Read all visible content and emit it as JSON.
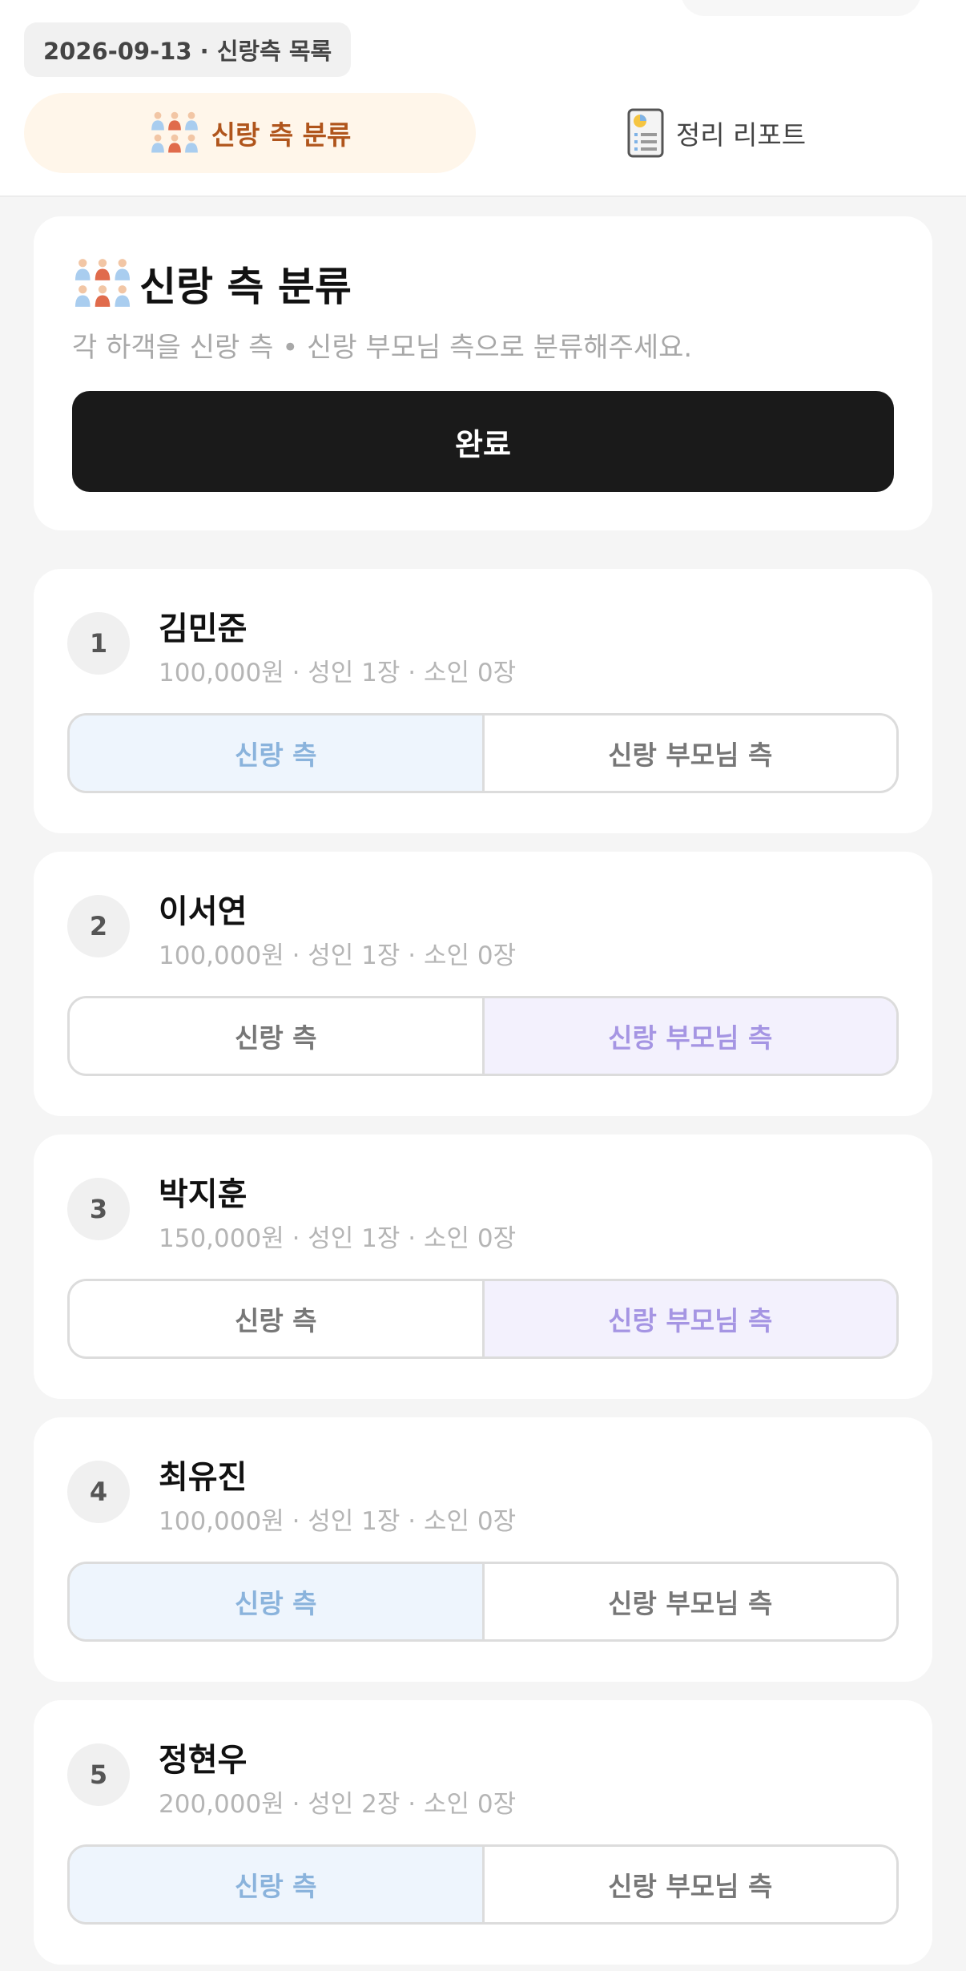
{
  "header": {
    "date_label": "2026-09-13 · 신랑측 목록",
    "tabs": [
      {
        "label": "신랑 측 분류",
        "icon": "people-group-icon",
        "active": true
      },
      {
        "label": "정리 리포트",
        "icon": "report-clipboard-icon",
        "active": false
      }
    ]
  },
  "intro": {
    "title": "신랑 측 분류",
    "subtitle": "각 하객을 신랑 측 • 신랑 부모님 측으로 분류해주세요.",
    "done_label": "완료"
  },
  "options": {
    "groom": "신랑 측",
    "parents": "신랑 부모님 측"
  },
  "guests": [
    {
      "no": "1",
      "name": "김민준",
      "detail": "100,000원 · 성인 1장 · 소인 0장",
      "side": "groom"
    },
    {
      "no": "2",
      "name": "이서연",
      "detail": "100,000원 · 성인 1장 · 소인 0장",
      "side": "parents"
    },
    {
      "no": "3",
      "name": "박지훈",
      "detail": "150,000원 · 성인 1장 · 소인 0장",
      "side": "parents"
    },
    {
      "no": "4",
      "name": "최유진",
      "detail": "100,000원 · 성인 1장 · 소인 0장",
      "side": "groom"
    },
    {
      "no": "5",
      "name": "정현우",
      "detail": "200,000원 · 성인 2장 · 소인 0장",
      "side": "groom"
    }
  ],
  "colors": {
    "accent_tab_bg": "#fff6ea",
    "accent_tab_text": "#b0551c",
    "groom_selected_bg": "#eef5fd",
    "groom_selected_text": "#8ab3dc",
    "parents_selected_bg": "#f3f1fd",
    "parents_selected_text": "#a595e3",
    "done_button_bg": "#1a1a1a"
  }
}
